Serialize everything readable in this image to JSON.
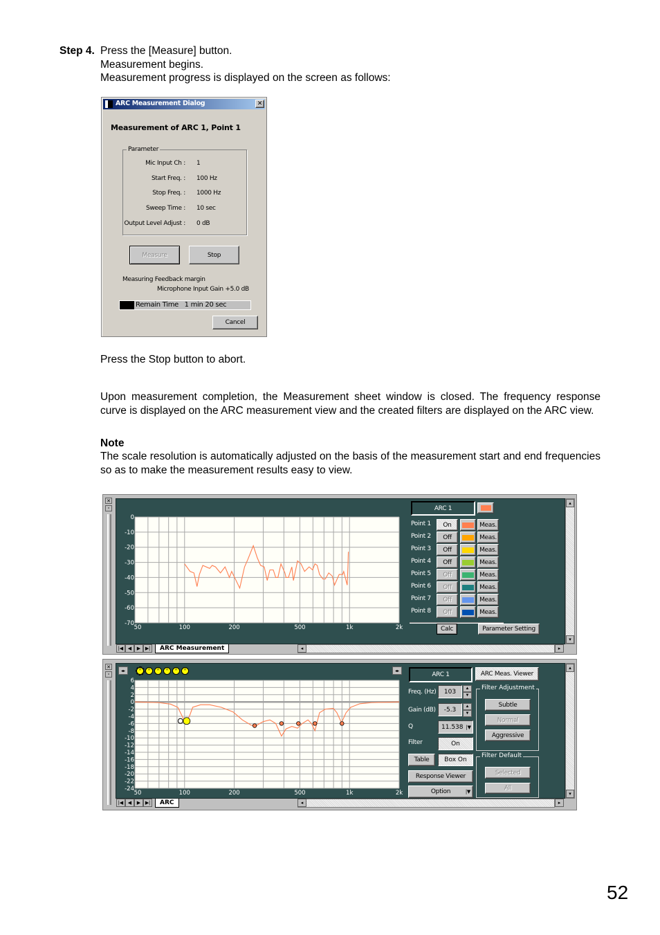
{
  "step": {
    "label": "Step 4.",
    "lines": [
      "Press the [Measure] button.",
      "Measurement begins.",
      "Measurement progress is displayed on the screen as follows:"
    ]
  },
  "dialog": {
    "title": "ARC Measurement Dialog",
    "heading": "Measurement of ARC 1, Point 1",
    "group_label": "Parameter",
    "params": [
      {
        "label": "Mic Input Ch :",
        "value": "1"
      },
      {
        "label": "Start Freq. :",
        "value": "100 Hz"
      },
      {
        "label": "Stop Freq. :",
        "value": "1000 Hz"
      },
      {
        "label": "Sweep Time :",
        "value": "10 sec"
      },
      {
        "label": "Output Level Adjust :",
        "value": "0 dB"
      }
    ],
    "measure_label": "Measure",
    "stop_label": "Stop",
    "status1": "Measuring Feedback margin",
    "status2": "Microphone Input Gain +5.0 dB",
    "progress_text": "Remain Time   1 min 20 sec",
    "progress_fraction": 0.11,
    "cancel_label": "Cancel"
  },
  "abort_text": "Press the Stop button to abort.",
  "completion_text": "Upon measurement completion, the Measurement sheet window is closed. The frequency response curve is displayed on the ARC measurement view and the created filters are displayed on the ARC view.",
  "note": {
    "title": "Note",
    "text": "The scale resolution is automatically adjusted on the basis of the measurement start and end frequencies so as to make the measurement results easy to view."
  },
  "measurement_view": {
    "tab": "ARC Measurement",
    "arc_label": "ARC 1",
    "arc_color": "#ff7f50",
    "points": [
      {
        "label": "Point 1",
        "state": "On",
        "color": "#ff7f50",
        "meas": "Meas.",
        "enabled": true
      },
      {
        "label": "Point 2",
        "state": "Off",
        "color": "#ffa500",
        "meas": "Meas.",
        "enabled": true
      },
      {
        "label": "Point 3",
        "state": "Off",
        "color": "#ffd700",
        "meas": "Meas.",
        "enabled": true
      },
      {
        "label": "Point 4",
        "state": "Off",
        "color": "#9acd32",
        "meas": "Meas.",
        "enabled": true
      },
      {
        "label": "Point 5",
        "state": "Off",
        "color": "#3cb371",
        "meas": "Meas.",
        "enabled": false
      },
      {
        "label": "Point 6",
        "state": "Off",
        "color": "#1e7f7f",
        "meas": "Meas.",
        "enabled": false
      },
      {
        "label": "Point 7",
        "state": "Off",
        "color": "#6495ed",
        "meas": "Meas.",
        "enabled": false
      },
      {
        "label": "Point 8",
        "state": "Off",
        "color": "#0050b0",
        "meas": "Meas.",
        "enabled": false
      }
    ],
    "calc_label": "Calc",
    "param_setting_label": "Parameter Setting",
    "chart": {
      "x_ticks": [
        {
          "v": 50,
          "l": "50"
        },
        {
          "v": 100,
          "l": "100"
        },
        {
          "v": 200,
          "l": "200"
        },
        {
          "v": 500,
          "l": "500"
        },
        {
          "v": 1000,
          "l": "1k"
        },
        {
          "v": 2000,
          "l": "2k"
        }
      ],
      "y_ticks": [
        "0",
        "-10",
        "-20",
        "-30",
        "-40",
        "-50",
        "-60",
        "-70"
      ],
      "xlim": [
        50,
        2000
      ],
      "ylim": [
        -70,
        0
      ],
      "log_x": true,
      "series_color": "#ff7f50",
      "data": [
        [
          100,
          -31
        ],
        [
          108,
          -36
        ],
        [
          114,
          -37
        ],
        [
          119,
          -46
        ],
        [
          123,
          -38
        ],
        [
          129,
          -32
        ],
        [
          142,
          -34
        ],
        [
          147,
          -32
        ],
        [
          154,
          -33
        ],
        [
          165,
          -37
        ],
        [
          176,
          -33
        ],
        [
          187,
          -40
        ],
        [
          193,
          -36
        ],
        [
          216,
          -47
        ],
        [
          231,
          -33
        ],
        [
          242,
          -28
        ],
        [
          261,
          -19
        ],
        [
          276,
          -27
        ],
        [
          289,
          -32
        ],
        [
          304,
          -33
        ],
        [
          317,
          -42
        ],
        [
          329,
          -35
        ],
        [
          345,
          -35
        ],
        [
          357,
          -40
        ],
        [
          368,
          -40
        ],
        [
          384,
          -31
        ],
        [
          406,
          -37
        ],
        [
          412,
          -40
        ],
        [
          426,
          -40
        ],
        [
          447,
          -33
        ],
        [
          457,
          -42
        ],
        [
          484,
          -29
        ],
        [
          508,
          -31
        ],
        [
          534,
          -36
        ],
        [
          569,
          -33
        ],
        [
          597,
          -35
        ],
        [
          617,
          -31
        ],
        [
          637,
          -32
        ],
        [
          658,
          -38
        ],
        [
          690,
          -41
        ],
        [
          713,
          -41
        ],
        [
          748,
          -37
        ],
        [
          785,
          -39
        ],
        [
          811,
          -45
        ],
        [
          865,
          -38
        ],
        [
          908,
          -38
        ],
        [
          922,
          -36
        ],
        [
          968,
          -45
        ],
        [
          978,
          -33
        ],
        [
          984,
          -23
        ]
      ]
    }
  },
  "arc_view": {
    "tab": "ARC",
    "arc_label": "ARC 1",
    "viewer_label": "ARC Meas. Viewer",
    "freq_label": "Freq. (Hz)",
    "freq_value": "103",
    "gain_label": "Gain (dB)",
    "gain_value": "-5.3",
    "q_label": "Q",
    "q_value": "11.538",
    "filter_label": "Filter",
    "filter_value": "On",
    "table_label": "Table",
    "box_label": "Box On",
    "response_label": "Response Viewer",
    "option_label": "Option",
    "adj_group": "Filter Adjustment",
    "subtle_label": "Subtle",
    "normal_label": "Normal",
    "aggressive_label": "Aggressive",
    "default_group": "Filter Default",
    "selected_label": "Selected",
    "all_label": "All",
    "chart": {
      "x_ticks": [
        {
          "v": 50,
          "l": "50"
        },
        {
          "v": 100,
          "l": "100"
        },
        {
          "v": 200,
          "l": "200"
        },
        {
          "v": 500,
          "l": "500"
        },
        {
          "v": 1000,
          "l": "1k"
        },
        {
          "v": 2000,
          "l": "2k"
        }
      ],
      "y_ticks": [
        "6",
        "4",
        "2",
        "0",
        "-2",
        "-4",
        "-6",
        "-8",
        "-10",
        "-12",
        "-14",
        "-16",
        "-18",
        "-20",
        "-22",
        "-24"
      ],
      "xlim": [
        50,
        2000
      ],
      "ylim": [
        -24,
        6
      ],
      "log_x": true,
      "series_color": "#ff7f50",
      "data": [
        [
          50,
          0
        ],
        [
          70,
          -0.2
        ],
        [
          82,
          -0.6
        ],
        [
          91,
          -1.5
        ],
        [
          98,
          -4.5
        ],
        [
          102,
          -5.5
        ],
        [
          107,
          -4
        ],
        [
          112,
          -1.5
        ],
        [
          125,
          -0.8
        ],
        [
          142,
          -0.8
        ],
        [
          167,
          -1.5
        ],
        [
          197,
          -2.8
        ],
        [
          224,
          -5
        ],
        [
          254,
          -6.5
        ],
        [
          271,
          -6.6
        ],
        [
          299,
          -5.5
        ],
        [
          329,
          -5
        ],
        [
          357,
          -6
        ],
        [
          387,
          -9.5
        ],
        [
          412,
          -7.5
        ],
        [
          447,
          -6.8
        ],
        [
          484,
          -7.3
        ],
        [
          517,
          -6
        ],
        [
          560,
          -5
        ],
        [
          588,
          -6
        ],
        [
          617,
          -8
        ],
        [
          658,
          -3
        ],
        [
          713,
          -2
        ],
        [
          798,
          -1.8
        ],
        [
          838,
          -3
        ],
        [
          894,
          -5.8
        ],
        [
          953,
          -3
        ],
        [
          1017,
          -1.5
        ],
        [
          1156,
          -0.5
        ],
        [
          1358,
          -0.2
        ],
        [
          2000,
          0
        ]
      ],
      "filters": [
        {
          "freq": 103,
          "gain": -5.3,
          "selected": true
        },
        {
          "freq": 266,
          "gain": -6.6
        },
        {
          "freq": 387,
          "gain": -6
        },
        {
          "freq": 490,
          "gain": -6
        },
        {
          "freq": 617,
          "gain": -6
        },
        {
          "freq": 900,
          "gain": -6
        }
      ],
      "filter_count": 6
    }
  },
  "page_number": "52"
}
